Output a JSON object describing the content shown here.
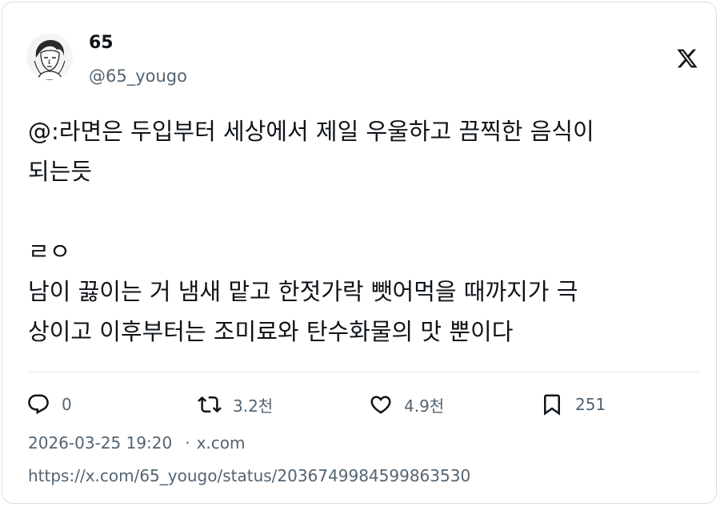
{
  "author": {
    "name": "65",
    "handle": "@65_yougo",
    "avatar_icon": "sketch-portrait-avatar"
  },
  "platform_icon": "x-logo-icon",
  "tweet": {
    "lines": [
      "@:라면은 두입부터 세상에서 제일 우울하고 끔찍한 음식이",
      "되는듯",
      "",
      "ㄹㅇ",
      "남이 끓이는 거 냄새 맡고 한젓가락 뺏어먹을 때까지가 극",
      "상이고 이후부터는 조미료와 탄수화물의 맛 뿐이다"
    ]
  },
  "actions": {
    "replies": {
      "icon": "reply-icon",
      "count": "0"
    },
    "retweets": {
      "icon": "retweet-icon",
      "count": "3.2천"
    },
    "likes": {
      "icon": "heart-icon",
      "count": "4.9천"
    },
    "bookmarks": {
      "icon": "bookmark-icon",
      "count": "251"
    }
  },
  "meta": {
    "timestamp": "2026-03-25 19:20",
    "separator": "·",
    "source": "x.com"
  },
  "url": "https://x.com/65_yougo/status/2036749984599863530",
  "colors": {
    "text": "#0f1419",
    "secondary": "#536471",
    "border": "#d9dde1"
  }
}
